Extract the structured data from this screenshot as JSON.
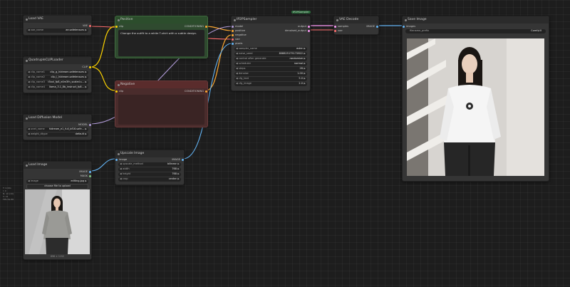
{
  "colors": {
    "clip": "#ffd500",
    "conditioning": "#ffa931",
    "model": "#b39ddb",
    "latent": "#ff9cf9",
    "vae": "#ff6e6e",
    "image": "#64b5f6",
    "mask": "#81c784"
  },
  "nodes": {
    "load_vae": {
      "title": "Load VAE",
      "out_vae": "VAE",
      "vae_name_label": "vae_name",
      "vae_name_value": "ae.safetensors"
    },
    "clip_loader": {
      "title": "QuadrupleCLIPLoader",
      "out_clip": "CLIP",
      "rows": [
        {
          "label": "clip_name1",
          "value": "clip_g_hidream.safetensors"
        },
        {
          "label": "clip_name2",
          "value": "clip_l_hidream.safetensors"
        },
        {
          "label": "clip_name3",
          "value": "t5xxl_fp8_e4m3fn_scaled.s..."
        },
        {
          "label": "clip_name4",
          "value": "llama_3.1_8b_instruct_fp8..."
        }
      ]
    },
    "diffusion": {
      "title": "Load Diffusion Model",
      "out_model": "MODEL",
      "rows": [
        {
          "label": "unet_name",
          "value": "hidream_e1_full_bf16.safe..."
        },
        {
          "label": "weight_dtype",
          "value": "default"
        }
      ]
    },
    "load_image": {
      "title": "Load Image",
      "out_image": "IMAGE",
      "out_mask": "MASK",
      "image_label": "image",
      "image_value": "editing.jpg",
      "upload_label": "choose file to upload",
      "size_caption": "896 × 1152"
    },
    "positive": {
      "title": "Positive",
      "in_clip": "clip",
      "out_cond": "CONDITIONING",
      "text": "Change the outfit to a white T-shirt with a subtle design."
    },
    "negative": {
      "title": "Negative",
      "in_clip": "clip",
      "out_cond": "CONDITIONING",
      "text": ""
    },
    "upscale": {
      "title": "Upscale Image",
      "in_image": "image",
      "out_image": "IMAGE",
      "rows": [
        {
          "label": "upscale_method",
          "value": "bilinear"
        },
        {
          "label": "width",
          "value": "768"
        },
        {
          "label": "height",
          "value": "768"
        },
        {
          "label": "crop",
          "value": "center"
        }
      ]
    },
    "ksampler": {
      "badge": "IP2PSampler",
      "title": "IP2PSampler",
      "inputs": [
        "model",
        "positive",
        "negative",
        "vae",
        "pixels"
      ],
      "out_output": "output",
      "out_denoised": "denoised_output",
      "rows": [
        {
          "label": "sampler_name",
          "value": "euler"
        },
        {
          "label": "noise_seed",
          "value": "808825175172822"
        },
        {
          "label": "control after generate",
          "value": "randomize"
        },
        {
          "label": "scheduler",
          "value": "normal"
        },
        {
          "label": "steps",
          "value": "28"
        },
        {
          "label": "denoise",
          "value": "1.00"
        },
        {
          "label": "cfg_text",
          "value": "5.0"
        },
        {
          "label": "cfg_image",
          "value": "2.0"
        }
      ]
    },
    "vae_decode": {
      "title": "VAE Decode",
      "in_samples": "samples",
      "in_vae": "vae",
      "out_image": "IMAGE"
    },
    "save_image": {
      "title": "Save Image",
      "in_images": "images",
      "prefix_label": "filename_prefix",
      "prefix_value": "ComfyUI"
    }
  },
  "stats": [
    "T: 0.00s",
    "I: 0",
    "N: 10 [10]",
    "V: 21",
    "FPS:59.88"
  ]
}
